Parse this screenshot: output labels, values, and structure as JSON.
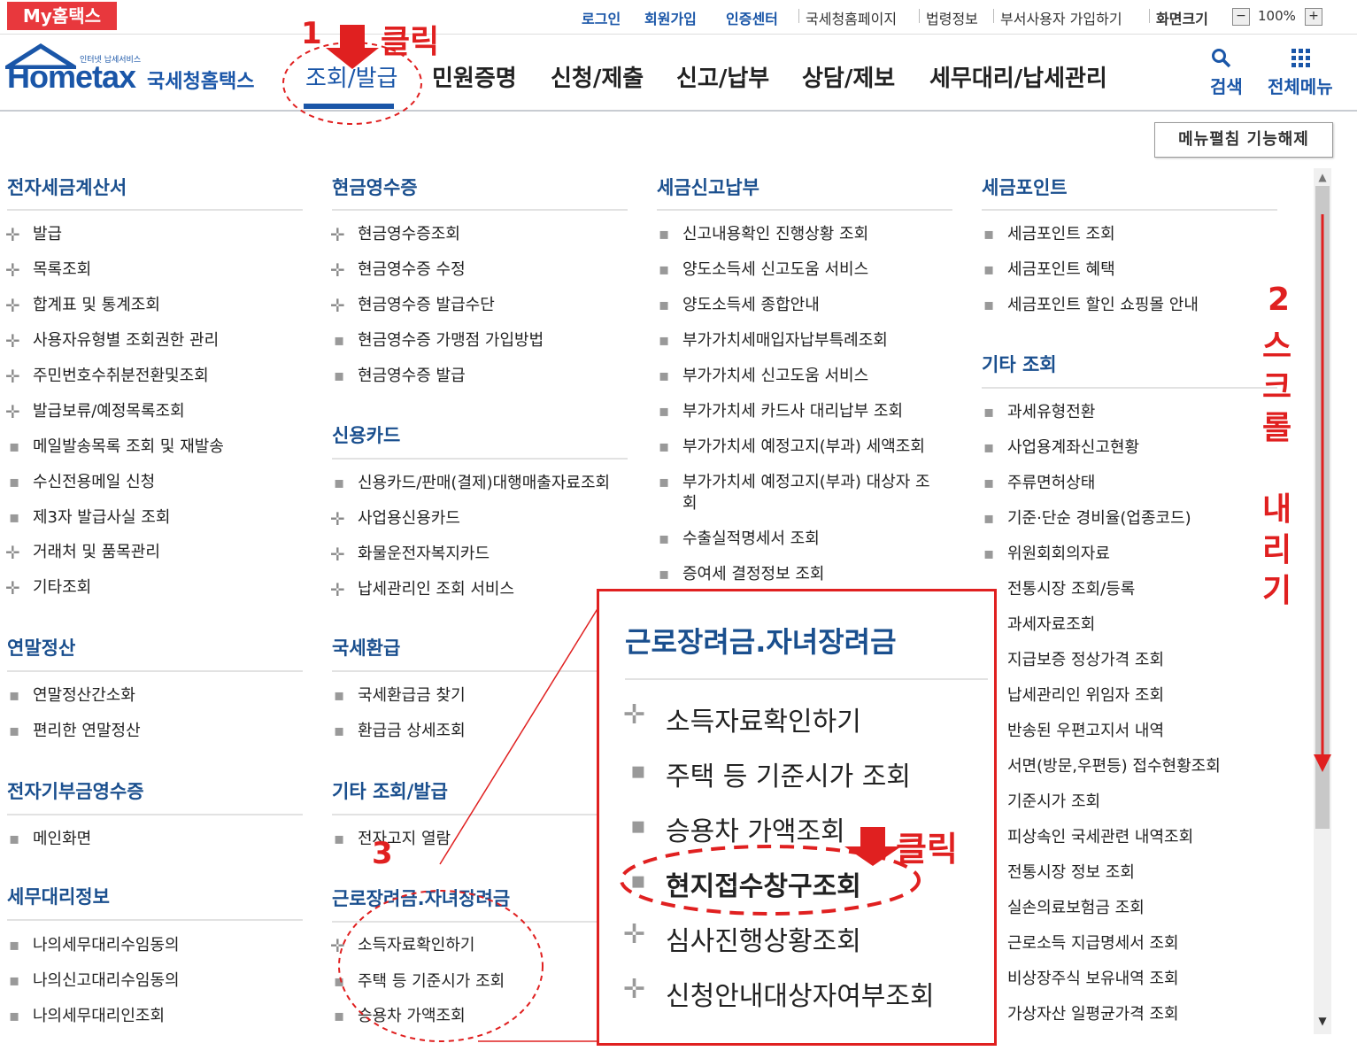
{
  "topbar": {
    "my_hometax": "My홈택스",
    "links": [
      "로그인",
      "회원가입",
      "인증센터",
      "국세청홈페이지",
      "법령정보",
      "부서사용자 가입하기",
      "화면크기"
    ],
    "zoom": "100%"
  },
  "header": {
    "logo": "Hometax",
    "logo_sub": "인터넷 납세서비스",
    "logo_kor": "국세청홈택스",
    "nav": [
      "조회/발급",
      "민원증명",
      "신청/제출",
      "신고/납부",
      "상담/제보",
      "세무대리/납세관리"
    ],
    "search": "검색",
    "allmenu": "전체메뉴"
  },
  "release_button": "메뉴펼침 기능해제",
  "col1": {
    "s1_title": "전자세금계산서",
    "s1_items": [
      "발급",
      "목록조회",
      "합계표 및 통계조회",
      "사용자유형별 조회권한 관리",
      "주민번호수취분전환및조회",
      "발급보류/예정목록조회",
      "메일발송목록 조회 및 재발송",
      "수신전용메일 신청",
      "제3자 발급사실 조회",
      "거래처 및 품목관리",
      "기타조회"
    ],
    "s2_title": "연말정산",
    "s2_items": [
      "연말정산간소화",
      "편리한 연말정산"
    ],
    "s3_title": "전자기부금영수증",
    "s3_items": [
      "메인화면"
    ],
    "s4_title": "세무대리정보",
    "s4_items": [
      "나의세무대리수임동의",
      "나의신고대리수임동의",
      "나의세무대리인조회"
    ]
  },
  "col2": {
    "s1_title": "현금영수증",
    "s1_items": [
      "현금영수증조회",
      "현금영수증 수정",
      "현금영수증 발급수단",
      "현금영수증 가맹점 가입방법",
      "현금영수증 발급"
    ],
    "s2_title": "신용카드",
    "s2_items": [
      "신용카드/판매(결제)대행매출자료조회",
      "사업용신용카드",
      "화물운전자복지카드",
      "납세관리인 조회 서비스"
    ],
    "s3_title": "국세환급",
    "s3_items": [
      "국세환급금 찾기",
      "환급금 상세조회"
    ],
    "s4_title": "기타 조회/발급",
    "s4_items": [
      "전자고지 열람"
    ],
    "s5_title": "근로장려금.자녀장려금",
    "s5_items": [
      "소득자료확인하기",
      "주택 등 기준시가 조회",
      "승용차 가액조회"
    ]
  },
  "col3": {
    "s1_title": "세금신고납부",
    "s1_items": [
      "신고내용확인 진행상황 조회",
      "양도소득세 신고도움 서비스",
      "양도소득세 종합안내",
      "부가가치세매입자납부특례조회",
      "부가가치세 신고도움 서비스",
      "부가가치세 카드사 대리납부 조회",
      "부가가치세 예정고지(부과) 세액조회",
      "부가가치세 예정고지(부과) 대상자 조",
      "회",
      "수출실적명세서 조회",
      "증여세 결정정보 조회"
    ]
  },
  "col4": {
    "s1_title": "세금포인트",
    "s1_items": [
      "세금포인트 조회",
      "세금포인트 혜택",
      "세금포인트 할인 쇼핑몰 안내"
    ],
    "s2_title": "기타 조회",
    "s2_items": [
      "과세유형전환",
      "사업용계좌신고현황",
      "주류면허상태",
      "기준·단순 경비율(업종코드)",
      "위원회회의자료",
      "전통시장 조회/등록",
      "과세자료조회",
      "지급보증 정상가격 조회",
      "납세관리인 위임자 조회",
      "반송된 우편고지서 내역",
      "서면(방문,우편등) 접수현황조회",
      "기준시가 조회",
      "피상속인 국세관련 내역조회",
      "전통시장 정보 조회",
      "실손의료보험금 조회",
      "근로소득 지급명세서 조회",
      "비상장주식 보유내역 조회",
      "가상자산 일평균가격 조회"
    ]
  },
  "zoom_panel": {
    "title": "근로장려금.자녀장려금",
    "items": [
      "소득자료확인하기",
      "주택 등 기준시가 조회",
      "승용차 가액조회",
      "현지접수창구조회",
      "심사진행상황조회",
      "신청안내대상자여부조회"
    ]
  },
  "annotations": {
    "step1": "1",
    "click1": "클릭",
    "step2": "2",
    "step2_text1": [
      "스",
      "크",
      "롤"
    ],
    "step2_text2": [
      "내",
      "리",
      "기"
    ],
    "step3": "3",
    "click3": "클릭"
  },
  "colors": {
    "brand": "#1a56a8",
    "accent": "#e8383d",
    "annotation": "#e02020"
  }
}
